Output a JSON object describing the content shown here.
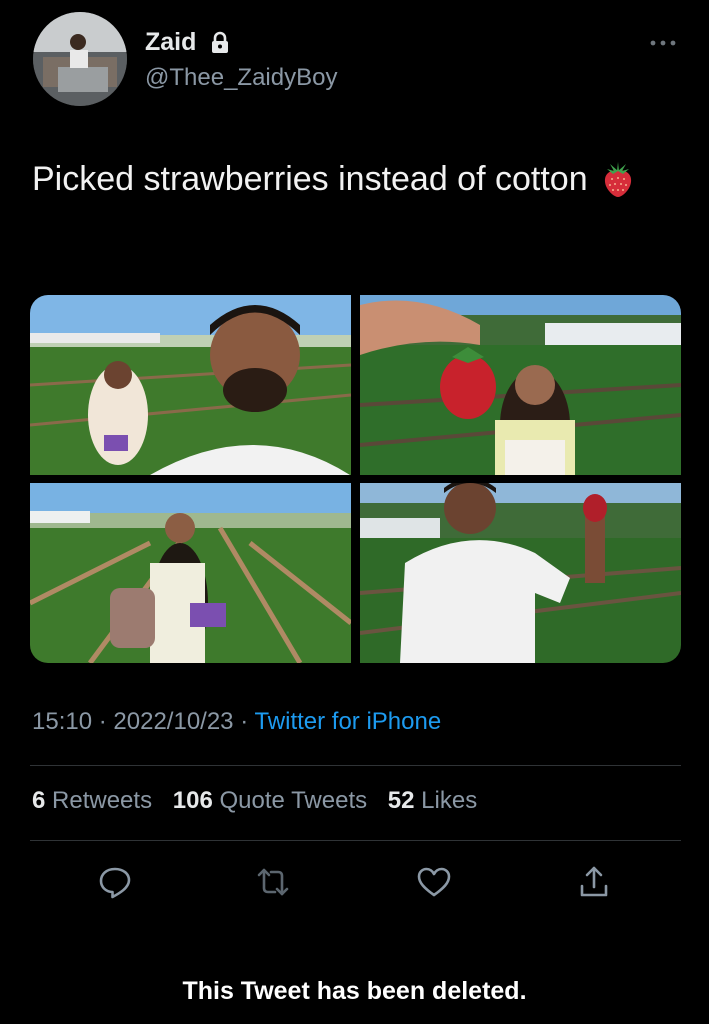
{
  "author": {
    "display_name": "Zaid",
    "handle": "@Thee_ZaidyBoy",
    "avatar_icon": "avatar-photo",
    "verified_lock": "lock-icon"
  },
  "tweet": {
    "text": "Picked strawberries instead of cotton",
    "emoji": "strawberry-icon",
    "media_count": 4
  },
  "meta": {
    "time": "15:10",
    "separator": "·",
    "date": "2022/10/23",
    "source": "Twitter for iPhone"
  },
  "stats": {
    "retweets_count": "6",
    "retweets_label": "Retweets",
    "quotes_count": "106",
    "quotes_label": "Quote Tweets",
    "likes_count": "52",
    "likes_label": "Likes"
  },
  "actions": [
    "reply-icon",
    "retweet-icon",
    "like-icon",
    "share-icon"
  ],
  "notice": {
    "deleted": "This Tweet has been deleted."
  },
  "colors": {
    "background": "#000000",
    "link": "#1d9bf0",
    "secondary_text": "#8b98a5",
    "divider": "#2f3336"
  }
}
